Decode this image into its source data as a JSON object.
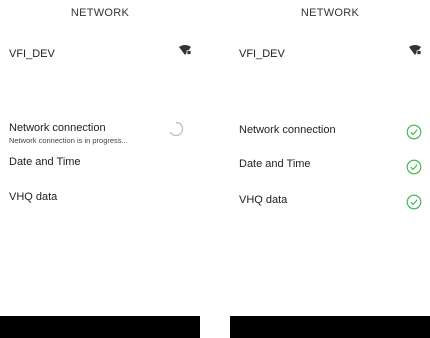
{
  "left_screen": {
    "title": "NETWORK",
    "wifi": {
      "ssid": "VFI_DEV",
      "icon": "wifi-lock-icon"
    },
    "items": [
      {
        "label": "Network connection",
        "sub": "Network connection is in progress...",
        "status": "loading-spinner-icon"
      },
      {
        "label": "Date and Time",
        "status": ""
      },
      {
        "label": "VHQ data",
        "status": ""
      }
    ]
  },
  "right_screen": {
    "title": "NETWORK",
    "wifi": {
      "ssid": "VFI_DEV",
      "icon": "wifi-lock-icon"
    },
    "items": [
      {
        "label": "Network connection",
        "status": "check-circle-icon"
      },
      {
        "label": "Date and Time",
        "status": "check-circle-icon"
      },
      {
        "label": "VHQ data",
        "status": "check-circle-icon"
      }
    ]
  },
  "colors": {
    "success": "#3cb34a",
    "spinner": "#bbbbbb",
    "bar": "#000000"
  }
}
